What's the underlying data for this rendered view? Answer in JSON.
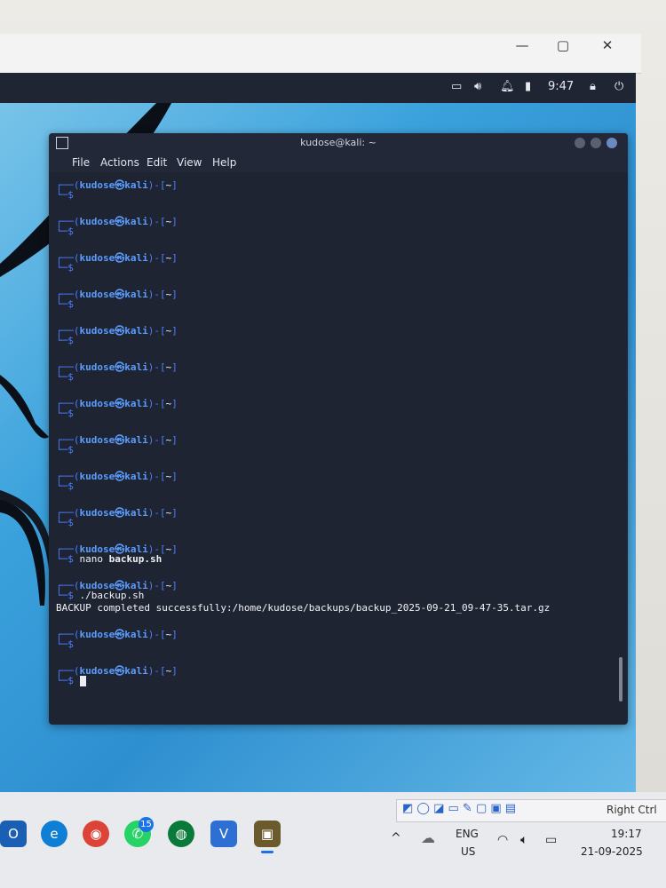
{
  "vm_window": {
    "controls": {
      "minimize": "—",
      "maximize": "▢",
      "close": "✕"
    }
  },
  "kali_panel": {
    "time": "9:47"
  },
  "terminal": {
    "title": "kudose@kali: ~",
    "menu": [
      "File",
      "Actions",
      "Edit",
      "View",
      "Help"
    ],
    "prompt_user": "kudose",
    "prompt_host": "kali",
    "prompt_dir": "~",
    "lines": [
      {
        "type": "prompt"
      },
      {
        "type": "prompt"
      },
      {
        "type": "prompt"
      },
      {
        "type": "prompt"
      },
      {
        "type": "prompt"
      },
      {
        "type": "prompt"
      },
      {
        "type": "prompt"
      },
      {
        "type": "prompt"
      },
      {
        "type": "prompt"
      },
      {
        "type": "prompt"
      },
      {
        "type": "prompt",
        "command": "nano",
        "arg": "backup.sh"
      },
      {
        "type": "prompt",
        "command": "./backup.sh"
      },
      {
        "type": "output",
        "text": "BACKUP completed successfully:/home/kudose/backups/backup_2025-09-21_09-47-35.tar.gz"
      },
      {
        "type": "prompt"
      },
      {
        "type": "prompt",
        "cursor": true
      }
    ]
  },
  "taskbar": {
    "right_ctrl_label": "Right Ctrl",
    "whatsapp_badge": "15",
    "lang_line1": "ENG",
    "lang_line2": "US",
    "clock_time": "19:17",
    "clock_date": "21-09-2025",
    "icons": [
      "outlook-icon",
      "edge-icon",
      "chrome-icon",
      "whatsapp-icon",
      "app-icon",
      "vmware-icon",
      "terminal-app-icon"
    ]
  },
  "colors": {
    "terminal_bg": "#1f2433",
    "prompt_blue": "#4d7dff",
    "desktop_blue": "#3aa1dc"
  }
}
